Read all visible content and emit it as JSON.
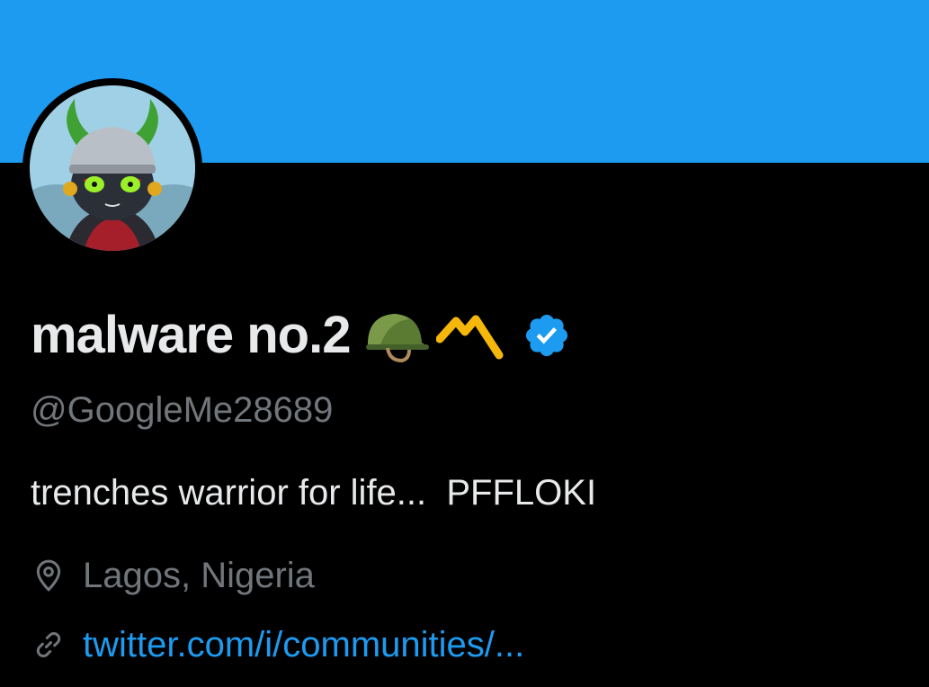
{
  "colors": {
    "banner": "#1d9bf0",
    "background": "#000000",
    "primary_text": "#e7e9ea",
    "secondary_text": "#71767b",
    "link": "#1d9bf0",
    "verified_badge": "#1d9bf0"
  },
  "profile": {
    "display_name": "malware no.2",
    "name_emojis": [
      "military-helmet-emoji",
      "yellow-chart-line-symbol"
    ],
    "verified_icon": "verified-badge-icon",
    "handle": "@GoogleMe28689",
    "bio": "trenches warrior for life...  PFFLOKI",
    "location": {
      "icon": "location-pin-icon",
      "text": "Lagos, Nigeria"
    },
    "website": {
      "icon": "link-icon",
      "text": "twitter.com/i/communities/..."
    },
    "avatar": "profile-avatar"
  }
}
